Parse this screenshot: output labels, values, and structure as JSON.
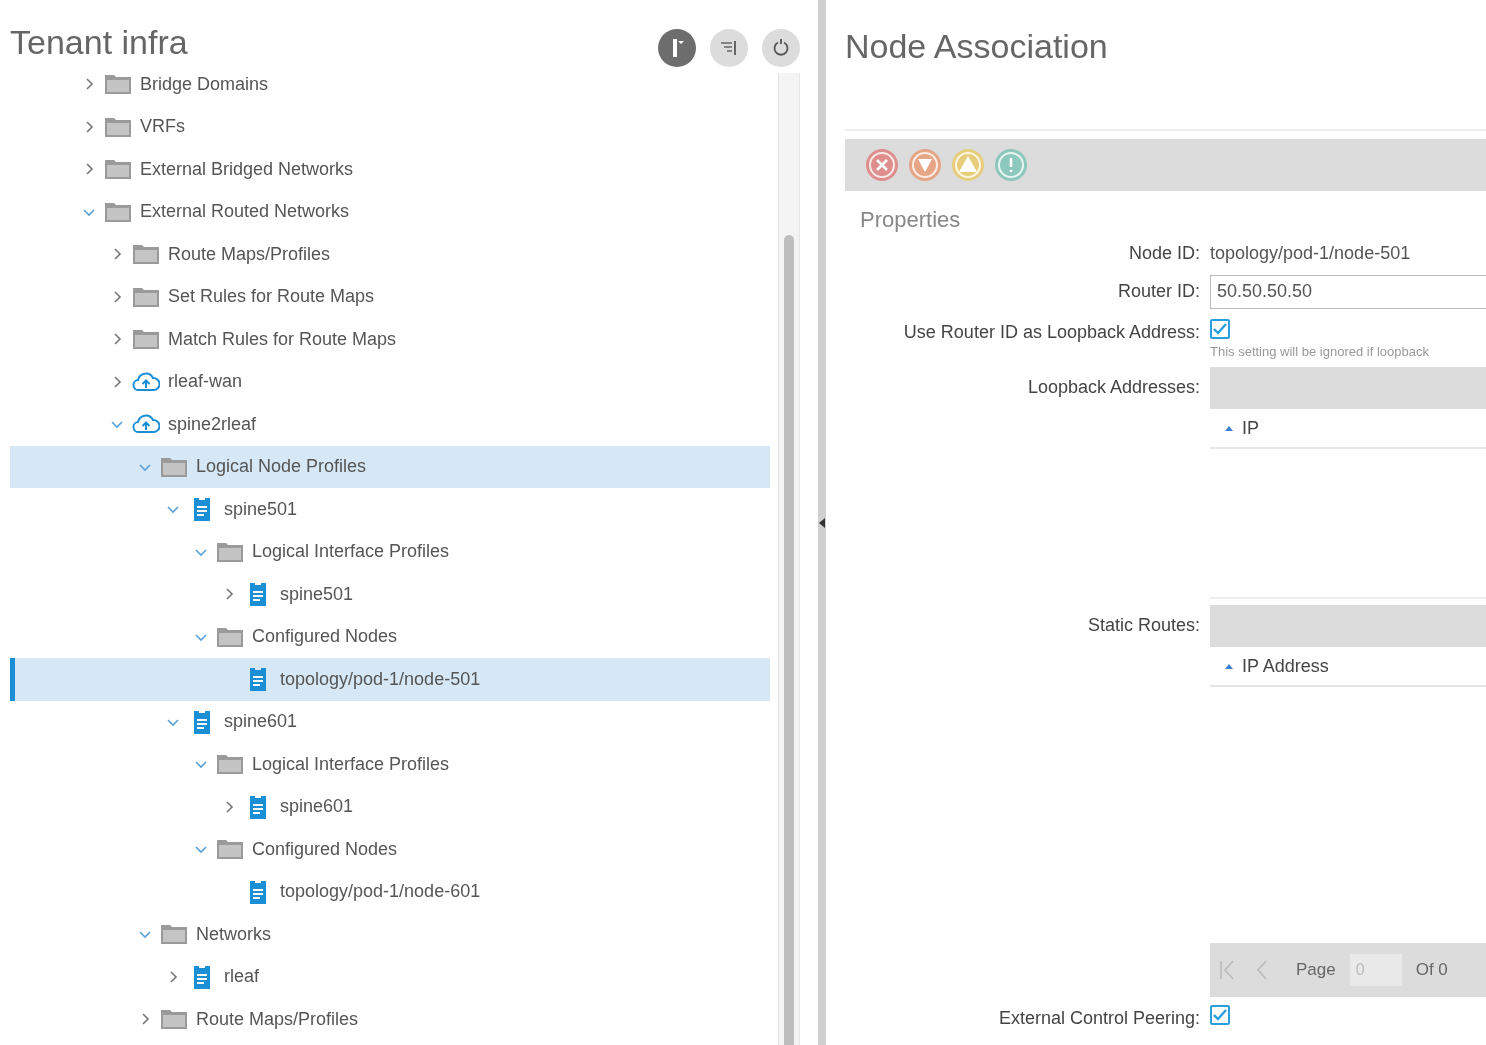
{
  "left_panel": {
    "title": "Tenant infra",
    "tree": [
      {
        "label": "Bridge Domains",
        "kind": "folder",
        "expanded": false,
        "selected": false
      },
      {
        "label": "VRFs",
        "kind": "folder",
        "expanded": false,
        "selected": false
      },
      {
        "label": "External Bridged Networks",
        "kind": "folder",
        "expanded": false,
        "selected": false
      },
      {
        "label": "External Routed Networks",
        "kind": "folder",
        "expanded": true,
        "selected": false,
        "children": [
          {
            "label": "Route Maps/Profiles",
            "kind": "folder",
            "expanded": false,
            "selected": false
          },
          {
            "label": "Set Rules for Route Maps",
            "kind": "folder",
            "expanded": false,
            "selected": false
          },
          {
            "label": "Match Rules for Route Maps",
            "kind": "folder",
            "expanded": false,
            "selected": false
          },
          {
            "label": "rleaf-wan",
            "kind": "cloud",
            "expanded": false,
            "selected": false
          },
          {
            "label": "spine2rleaf",
            "kind": "cloud",
            "expanded": true,
            "selected": false,
            "children": [
              {
                "label": "Logical Node Profiles",
                "kind": "folder",
                "expanded": true,
                "selected": false,
                "hovered": true,
                "children": [
                  {
                    "label": "spine501",
                    "kind": "doc",
                    "expanded": true,
                    "selected": false,
                    "children": [
                      {
                        "label": "Logical Interface Profiles",
                        "kind": "folder",
                        "expanded": true,
                        "selected": false,
                        "children": [
                          {
                            "label": "spine501",
                            "kind": "doc",
                            "expanded": false,
                            "selected": false
                          }
                        ]
                      },
                      {
                        "label": "Configured Nodes",
                        "kind": "folder",
                        "expanded": true,
                        "selected": false,
                        "children": [
                          {
                            "label": "topology/pod-1/node-501",
                            "kind": "doc",
                            "selected": true
                          }
                        ]
                      }
                    ]
                  },
                  {
                    "label": "spine601",
                    "kind": "doc",
                    "expanded": true,
                    "selected": false,
                    "children": [
                      {
                        "label": "Logical Interface Profiles",
                        "kind": "folder",
                        "expanded": true,
                        "selected": false,
                        "children": [
                          {
                            "label": "spine601",
                            "kind": "doc",
                            "expanded": false,
                            "selected": false
                          }
                        ]
                      },
                      {
                        "label": "Configured Nodes",
                        "kind": "folder",
                        "expanded": true,
                        "selected": false,
                        "children": [
                          {
                            "label": "topology/pod-1/node-601",
                            "kind": "doc",
                            "selected": false
                          }
                        ]
                      }
                    ]
                  }
                ]
              },
              {
                "label": "Networks",
                "kind": "folder",
                "expanded": true,
                "selected": false,
                "children": [
                  {
                    "label": "rleaf",
                    "kind": "doc",
                    "expanded": false,
                    "selected": false
                  }
                ]
              },
              {
                "label": "Route Maps/Profiles",
                "kind": "folder",
                "expanded": false,
                "selected": false
              }
            ]
          }
        ]
      }
    ]
  },
  "right_panel": {
    "title": "Node Association",
    "section": "Properties",
    "fields": [
      {
        "kind": "text",
        "label": "Node ID:",
        "value": "topology/pod-1/node-501"
      },
      {
        "kind": "input",
        "label": "Router ID:",
        "value": "50.50.50.50"
      },
      {
        "kind": "checkbox",
        "label": "Use Router ID as Loopback Address:",
        "checked": true,
        "hint": "This setting will be ignored if loopback"
      },
      {
        "kind": "table",
        "label": "Loopback Addresses:",
        "column": "IP"
      },
      {
        "kind": "table",
        "label": "Static Routes:",
        "column": "IP Address",
        "pagination": {
          "page_label": "Page",
          "page_value": "0",
          "total": "Of 0"
        }
      },
      {
        "kind": "checkbox",
        "label": "External Control Peering:",
        "checked": true
      }
    ]
  }
}
